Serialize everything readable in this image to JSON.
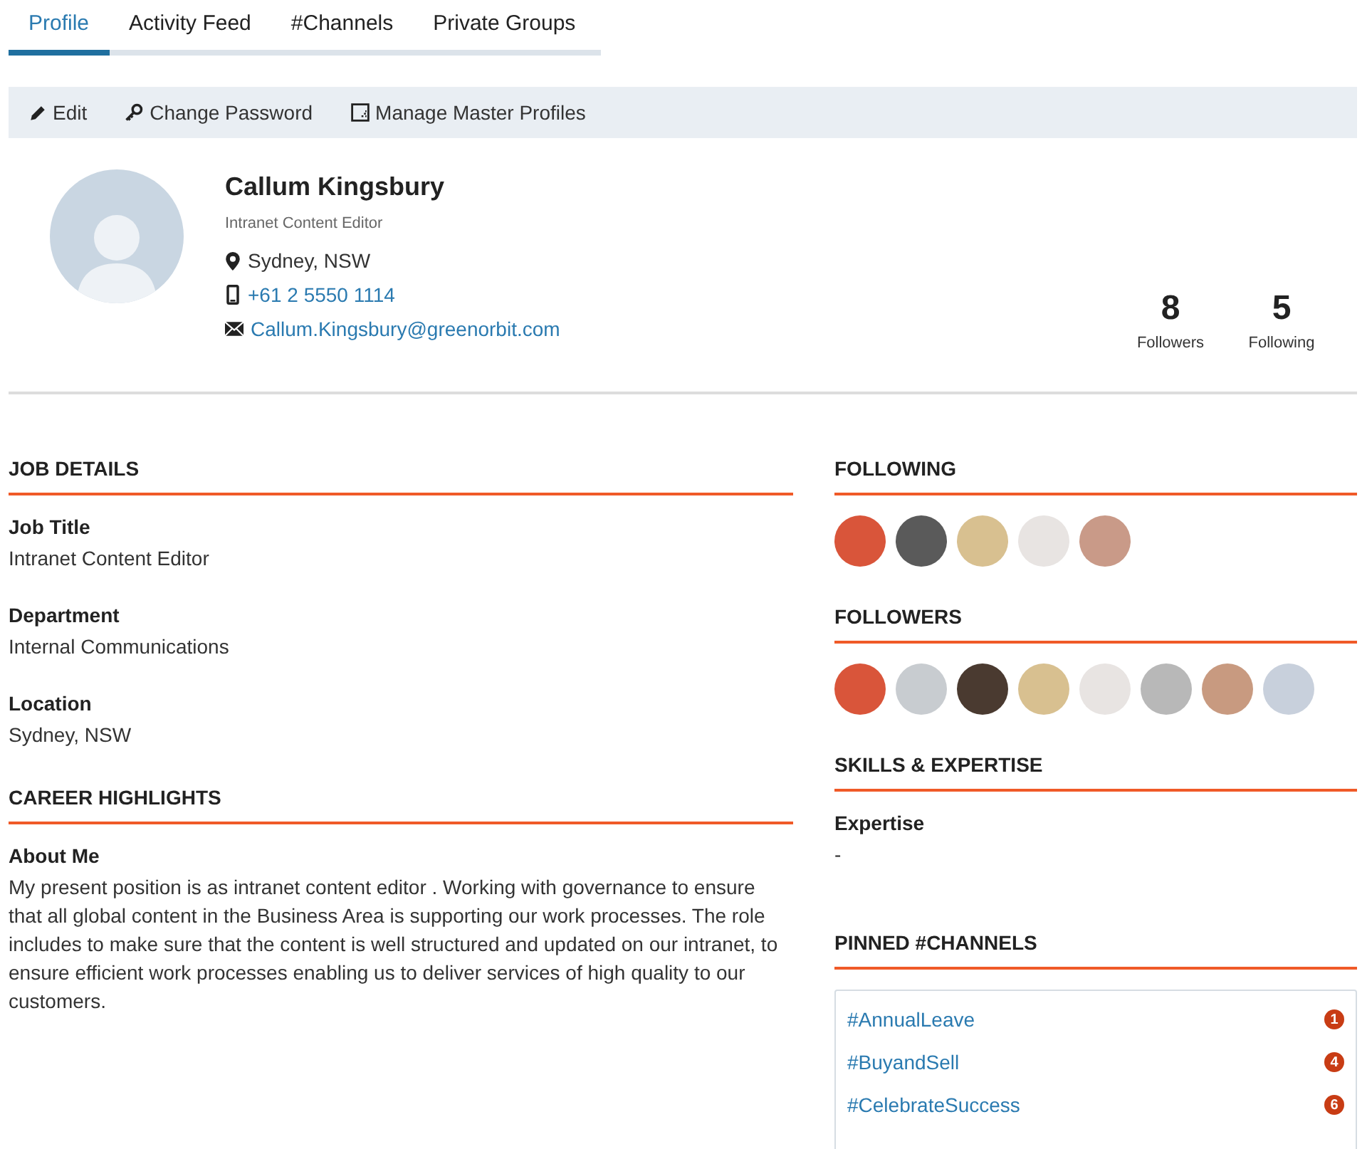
{
  "tabs": [
    {
      "label": "Profile",
      "selected": true
    },
    {
      "label": "Activity Feed",
      "selected": false
    },
    {
      "label": "#Channels",
      "selected": false
    },
    {
      "label": "Private Groups",
      "selected": false
    }
  ],
  "toolbar": [
    {
      "kind": "edit",
      "label": "Edit"
    },
    {
      "kind": "password",
      "label": "Change Password"
    },
    {
      "kind": "manage",
      "label": "Manage Master Profiles"
    }
  ],
  "profile": {
    "name": "Callum Kingsbury",
    "title": "Intranet Content Editor",
    "location": "Sydney, NSW",
    "phone": "+61 2 5550 1114",
    "email": "Callum.Kingsbury@greenorbit.com",
    "stats": [
      {
        "value": "8",
        "label": "Followers"
      },
      {
        "value": "5",
        "label": "Following"
      }
    ]
  },
  "job_details": {
    "title": "JOB DETAILS",
    "fields": [
      {
        "label": "Job Title",
        "value": "Intranet Content Editor"
      },
      {
        "label": "Department",
        "value": "Internal Communications"
      },
      {
        "label": "Location",
        "value": "Sydney, NSW"
      }
    ]
  },
  "career_highlights": {
    "title": "CAREER HIGHLIGHTS",
    "fields": [
      {
        "label": "About Me",
        "value": "My present position is as intranet content editor . Working with governance to ensure that all global content in the Business Area is supporting our work processes. The role includes to make sure that the content is well structured and updated on our intranet, to ensure efficient work processes enabling us to deliver services of high quality to our customers."
      }
    ]
  },
  "following": {
    "title": "FOLLOWING",
    "avatars": [
      {
        "color": "#d9553a"
      },
      {
        "color": "#5a5a5a"
      },
      {
        "color": "#d8c090"
      },
      {
        "color": "#e8e4e2"
      },
      {
        "color": "#c99a88"
      }
    ]
  },
  "followers": {
    "title": "FOLLOWERS",
    "avatars": [
      {
        "color": "#d9553a"
      },
      {
        "color": "#c8ccd0"
      },
      {
        "color": "#4a3a30"
      },
      {
        "color": "#d8c090"
      },
      {
        "color": "#e8e4e2"
      },
      {
        "color": "#b8b8b8"
      },
      {
        "color": "#c89a80"
      },
      {
        "color": "#c8d0dc"
      }
    ]
  },
  "skills": {
    "title": "SKILLS & EXPERTISE",
    "fields": [
      {
        "label": "Expertise",
        "value": "-"
      }
    ]
  },
  "pinned_channels": {
    "title": "PINNED #CHANNELS",
    "items": [
      {
        "name": "#AnnualLeave",
        "count": "1"
      },
      {
        "name": "#BuyandSell",
        "count": "4"
      },
      {
        "name": "#CelebrateSuccess",
        "count": "6"
      }
    ]
  }
}
